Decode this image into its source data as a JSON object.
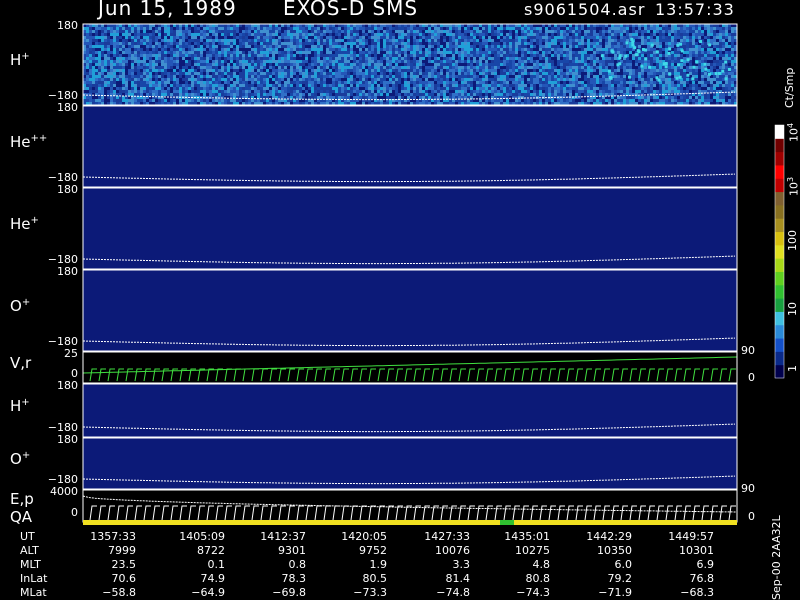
{
  "title": {
    "date": "Jun 15, 1989",
    "instrument": "EXOS-D SMS",
    "file": "s9061504.asr",
    "time": "13:57:33"
  },
  "colorbar": {
    "unit": "Ct/Smp",
    "ticks": [
      "1",
      "10",
      "100",
      "10",
      "10"
    ],
    "tick_sups": [
      "",
      "",
      "",
      "3",
      "4"
    ],
    "colors": [
      "#00004d",
      "#0a2a8a",
      "#1450c8",
      "#2a8ad8",
      "#40c0e0",
      "#18a040",
      "#30c030",
      "#60d020",
      "#a8d818",
      "#e0e020",
      "#d8c010",
      "#a89020",
      "#887020",
      "#806030",
      "#c00000",
      "#ff0000",
      "#a00000",
      "#700000",
      "#ffffff"
    ]
  },
  "side_label": "Sep-00  2AA32L",
  "chart_data": {
    "type": "heatmap",
    "panels": [
      {
        "label": "H",
        "sup": "+",
        "ytop": "180",
        "ybot": "−180",
        "intensity": "high"
      },
      {
        "label": "He",
        "sup": "++",
        "ytop": "180",
        "ybot": "−180",
        "intensity": "low"
      },
      {
        "label": "He",
        "sup": "+",
        "ytop": "180",
        "ybot": "−180",
        "intensity": "low"
      },
      {
        "label": "O",
        "sup": "+",
        "ytop": "180",
        "ybot": "−180",
        "intensity": "low"
      },
      {
        "label": "V,r",
        "sup": "",
        "ytop": "25",
        "ybot": "0",
        "right_top": "90",
        "right_bot": "0",
        "type": "line"
      },
      {
        "label": "H",
        "sup": "+",
        "ytop": "180",
        "ybot": "−180",
        "intensity": "low"
      },
      {
        "label": "O",
        "sup": "+",
        "ytop": "180",
        "ybot": "−180",
        "intensity": "low"
      },
      {
        "label": "E,p",
        "sup": "",
        "label2": "QA",
        "ytop": "4000",
        "ybot": "0",
        "right_top": "90",
        "right_bot": "0",
        "type": "line"
      }
    ]
  },
  "ephemeris": {
    "rows": [
      {
        "name": "UT",
        "values": [
          "1357:33",
          "1405:09",
          "1412:37",
          "1420:05",
          "1427:33",
          "1435:01",
          "1442:29",
          "1449:57"
        ]
      },
      {
        "name": "ALT",
        "values": [
          "7999",
          "8722",
          "9301",
          "9752",
          "10076",
          "10275",
          "10350",
          "10301"
        ]
      },
      {
        "name": "MLT",
        "values": [
          "23.5",
          "0.1",
          "0.8",
          "1.9",
          "3.3",
          "4.8",
          "6.0",
          "6.9"
        ]
      },
      {
        "name": "InLat",
        "values": [
          "70.6",
          "74.9",
          "78.3",
          "80.5",
          "81.4",
          "80.8",
          "79.2",
          "76.8"
        ]
      },
      {
        "name": "MLat",
        "values": [
          "−58.8",
          "−64.9",
          "−69.8",
          "−73.3",
          "−74.8",
          "−74.3",
          "−71.9",
          "−68.3"
        ]
      }
    ]
  }
}
